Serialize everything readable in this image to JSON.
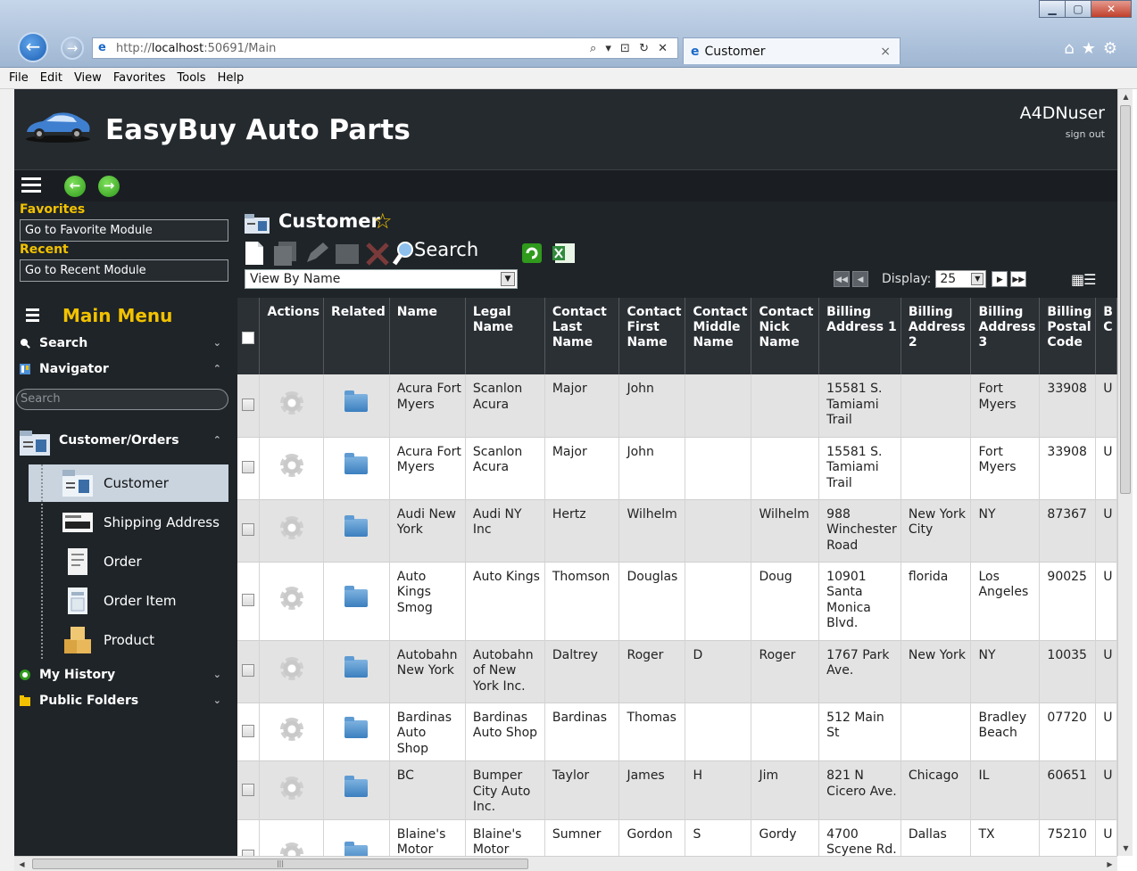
{
  "browser": {
    "url_prefix": "http://",
    "url_host": "localhost",
    "url_rest": ":50691/Main",
    "address_tools": "⌕ ▾ ⊡ ↻ ✕",
    "tab_title": "Customer",
    "tab_close": "×",
    "menu": [
      "File",
      "Edit",
      "View",
      "Favorites",
      "Tools",
      "Help"
    ]
  },
  "app": {
    "title": "EasyBuy Auto Parts",
    "user": "A4DNuser",
    "signout": "sign out"
  },
  "sidebar": {
    "favorites_title": "Favorites",
    "favorites_box": "Go to Favorite Module",
    "recent_title": "Recent",
    "recent_box": "Go to Recent Module",
    "main_menu": "Main Menu",
    "search_label": "Search",
    "navigator_label": "Navigator",
    "search_placeholder": "Search",
    "group_label": "Customer/Orders",
    "items": [
      "Customer",
      "Shipping Address",
      "Order",
      "Order Item",
      "Product"
    ],
    "my_history": "My History",
    "public_folders": "Public Folders"
  },
  "content": {
    "title": "Customer",
    "search_label": "Search",
    "view_select": "View By Name",
    "display_label": "Display:",
    "display_value": "25"
  },
  "table": {
    "headers": [
      "Actions",
      "Related",
      "Name",
      "Legal Name",
      "Contact Last Name",
      "Contact First Name",
      "Contact Middle Name",
      "Contact Nick Name",
      "Billing Address 1",
      "Billing Address 2",
      "Billing Address 3",
      "Billing Postal Code",
      "B C"
    ],
    "rows": [
      [
        "Acura Fort Myers",
        "Scanlon Acura",
        "Major",
        "John",
        "",
        "",
        "15581 S. Tamiami Trail",
        "",
        "Fort Myers",
        "33908",
        "U"
      ],
      [
        "Acura Fort Myers",
        "Scanlon Acura",
        "Major",
        "John",
        "",
        "",
        "15581 S. Tamiami Trail",
        "",
        "Fort Myers",
        "33908",
        "U"
      ],
      [
        "Audi New York",
        "Audi NY Inc",
        "Hertz",
        "Wilhelm",
        "",
        "Wilhelm",
        "988 Winchester Road",
        "New York City",
        "NY",
        "87367",
        "U"
      ],
      [
        "Auto Kings Smog",
        "Auto Kings",
        "Thomson",
        "Douglas",
        "",
        "Doug",
        "10901 Santa Monica Blvd.",
        "florida",
        "Los Angeles",
        "90025",
        "U"
      ],
      [
        "Autobahn New York",
        "Autobahn of New York Inc.",
        "Daltrey",
        "Roger",
        "D",
        "Roger",
        "1767 Park Ave.",
        "New York",
        "NY",
        "10035",
        "U"
      ],
      [
        "Bardinas Auto Shop",
        "Bardinas Auto Shop",
        "Bardinas",
        "Thomas",
        "",
        "",
        "512 Main St",
        "",
        "Bradley Beach",
        "07720",
        "U"
      ],
      [
        "BC",
        "Bumper City Auto Inc.",
        "Taylor",
        "James",
        "H",
        "Jim",
        "821 N Cicero Ave.",
        "Chicago",
        "IL",
        "60651",
        "U"
      ],
      [
        "Blaine's Motor Supply",
        "Blaine's Motor Supply Inc.",
        "Sumner",
        "Gordon",
        "S",
        "Gordy",
        "4700 Scyene Rd.",
        "Dallas",
        "TX",
        "75210",
        "U"
      ]
    ]
  },
  "colors": {
    "accent": "#f2c200",
    "header_bg": "#252a2e",
    "table_header_bg": "#2b3035"
  }
}
